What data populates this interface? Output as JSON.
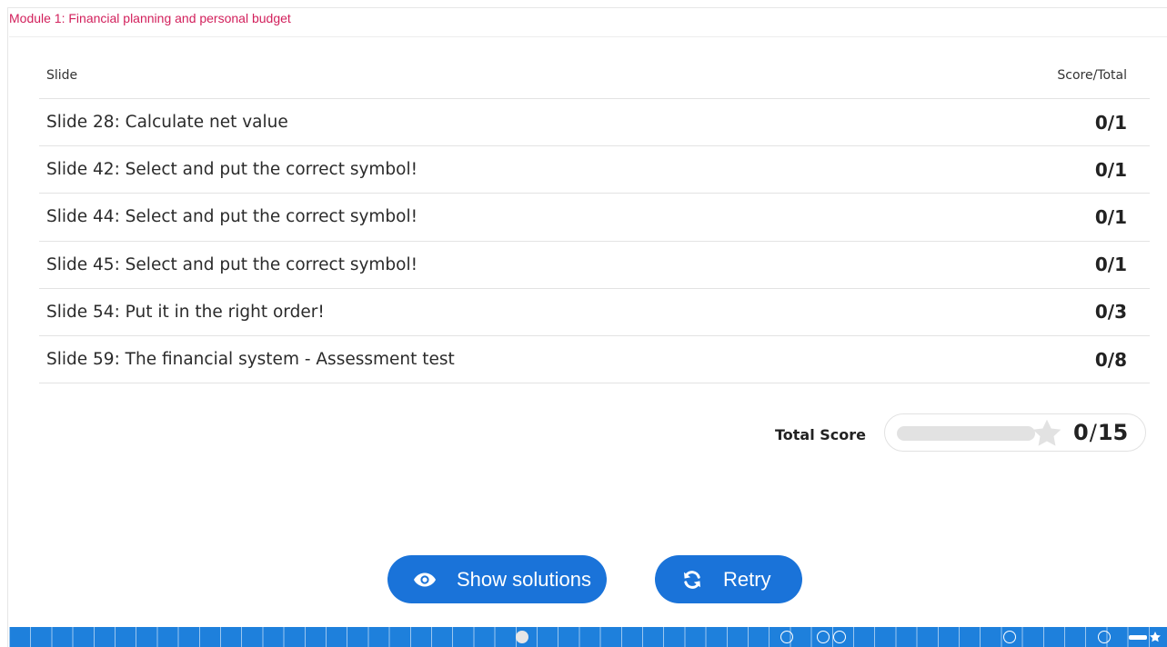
{
  "module_title": "Module 1: Financial planning and personal budget",
  "table": {
    "col_slide": "Slide",
    "col_score": "Score/Total",
    "rows": [
      {
        "title": "Slide 28: Calculate net value",
        "score": "0/1"
      },
      {
        "title": "Slide 42: Select and put the correct symbol!",
        "score": "0/1"
      },
      {
        "title": "Slide 44: Select and put the correct symbol!",
        "score": "0/1"
      },
      {
        "title": "Slide 45: Select and put the correct symbol!",
        "score": "0/1"
      },
      {
        "title": "Slide 54: Put it in the right order!",
        "score": "0/3"
      },
      {
        "title": "Slide 59: The financial system - Assessment test",
        "score": "0/8"
      }
    ]
  },
  "total": {
    "label": "Total Score",
    "score": "0",
    "separator": "/",
    "max": "15",
    "progress": 0
  },
  "buttons": {
    "show_solutions": "Show solutions",
    "retry": "Retry"
  },
  "icons": {
    "show_solutions": "eye-icon",
    "retry": "retry-icon",
    "score": "star-icon"
  },
  "colors": {
    "accent": "#1a73d9",
    "module_title": "#d21f5b",
    "bar": "#1e80dc"
  }
}
